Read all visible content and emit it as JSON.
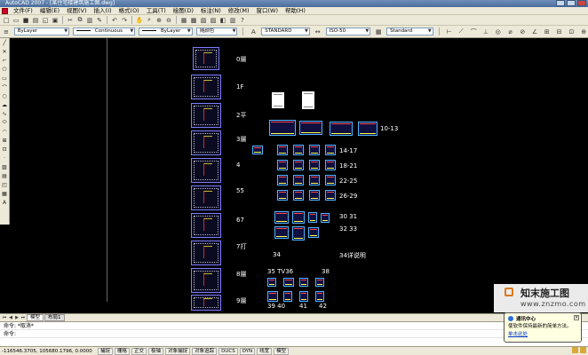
{
  "window": {
    "title": "AutoCAD 2007 - [某住宅楼建筑施工图.dwg]"
  },
  "menu": {
    "items": [
      "文件(F)",
      "编辑(E)",
      "视图(V)",
      "插入(I)",
      "格式(O)",
      "工具(T)",
      "绘图(D)",
      "标注(N)",
      "修改(M)",
      "窗口(W)",
      "帮助(H)"
    ]
  },
  "properties_bar": {
    "layer_color": "ByLayer",
    "linetype": "Continuous",
    "lineweight": "ByLayer",
    "plot_style": "随颜色",
    "text_style": "STANDARD",
    "dim_style": "ISO-50",
    "table_style": "Standard"
  },
  "drawing": {
    "floor_labels": [
      "0層",
      "1F",
      "2平",
      "3層",
      "4",
      "55",
      "67",
      "7打",
      "8層",
      "9層"
    ],
    "sheet_labels": [
      "10-13",
      "14-17",
      "18-21",
      "22-25",
      "26-29",
      "30 31",
      "32 33",
      "34",
      "34详说明",
      "35 TV36",
      "38",
      "39 40",
      "41",
      "42"
    ]
  },
  "layout_tabs": [
    "模型",
    "布局1"
  ],
  "command": {
    "history": "命令: *取消*",
    "prompt": "命令:"
  },
  "status": {
    "coordinates": "-116546.3705, 105680.1796, 0.0000",
    "toggles": [
      "捕捉",
      "栅格",
      "正交",
      "极轴",
      "对象捕捉",
      "对象追踪",
      "DUCS",
      "DYN",
      "线宽",
      "模型"
    ]
  },
  "watermark": {
    "name": "知末施工图",
    "url": "www.znzmo.com"
  },
  "notification": {
    "title": "通讯中心",
    "message": "使软件保持最新的简单方法。",
    "link": "单击此处"
  },
  "colors": {
    "canvas": "#000000",
    "chrome": "#ece9d8",
    "sheet_border": "#7d7dff",
    "title_bar": "#4a6d9c"
  }
}
